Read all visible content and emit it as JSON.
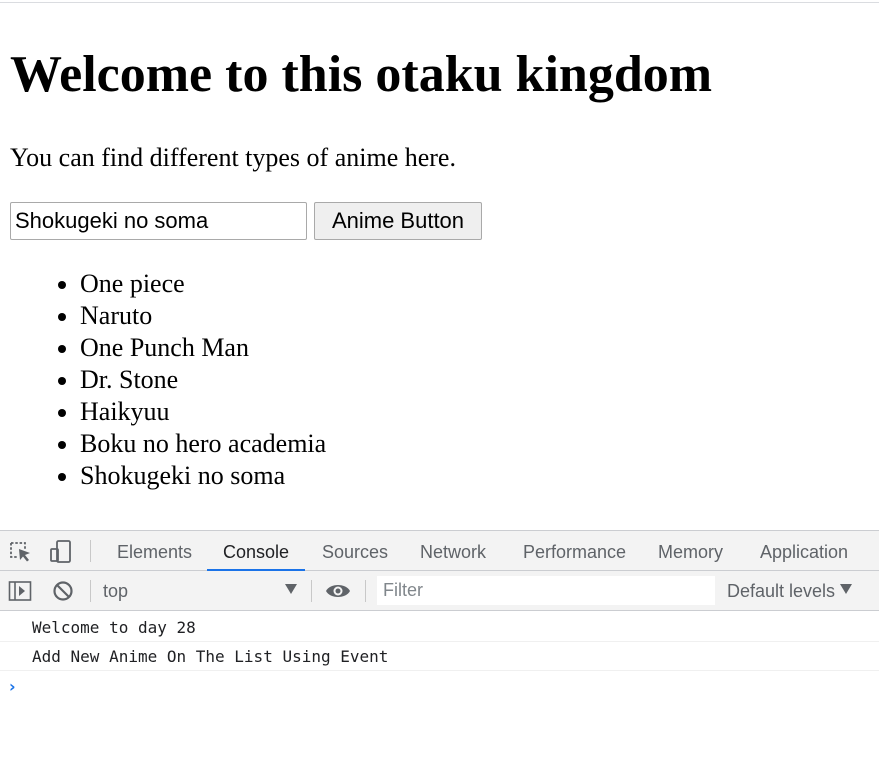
{
  "page": {
    "title": "Welcome to this otaku kingdom",
    "subtitle": "You can find different types of anime here.",
    "input_value": "Shokugeki no soma",
    "button_label": "Anime Button",
    "anime_list": [
      "One piece",
      "Naruto",
      "One Punch Man",
      "Dr. Stone",
      "Haikyuu",
      "Boku no hero academia",
      "Shokugeki no soma"
    ]
  },
  "devtools": {
    "tabs": [
      {
        "label": "Elements",
        "active": false
      },
      {
        "label": "Console",
        "active": true
      },
      {
        "label": "Sources",
        "active": false
      },
      {
        "label": "Network",
        "active": false
      },
      {
        "label": "Performance",
        "active": false
      },
      {
        "label": "Memory",
        "active": false
      },
      {
        "label": "Application",
        "active": false
      }
    ],
    "toolbar": {
      "context": "top",
      "filter_placeholder": "Filter",
      "levels": "Default levels"
    },
    "console_messages": [
      "Welcome to day 28",
      "Add New Anime On The List Using Event"
    ],
    "accent_color": "#1a73e8"
  }
}
